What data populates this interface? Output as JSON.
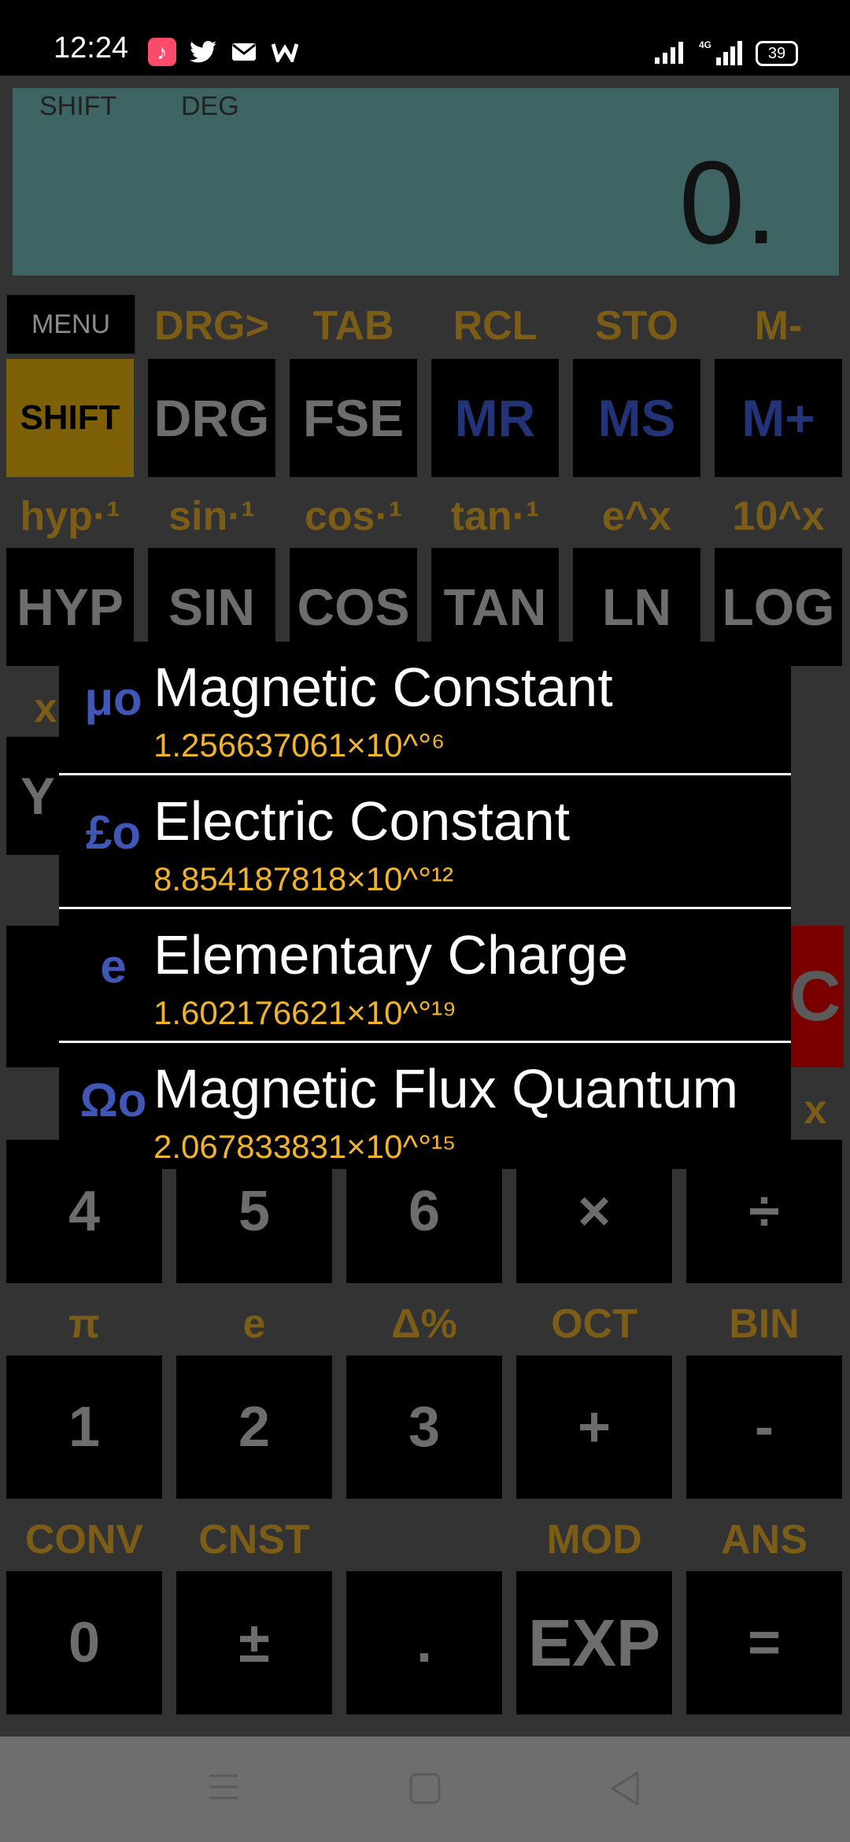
{
  "status_bar": {
    "time": "12:24",
    "icons": [
      "music-icon",
      "twitter-icon",
      "mail-icon",
      "w-icon",
      "signal-icon",
      "4g-signal-icon",
      "battery-icon"
    ],
    "network": "4G",
    "battery": "39"
  },
  "display": {
    "shift_indicator": "SHIFT",
    "angle_mode": "DEG",
    "value": "0."
  },
  "menu_label": "MENU",
  "row1_secondary": [
    "DRG>",
    "TAB",
    "RCL",
    "STO",
    "M-"
  ],
  "row1_keys": [
    "SHIFT",
    "DRG",
    "FSE",
    "MR",
    "MS",
    "M+"
  ],
  "row2_secondary": [
    "hyp·¹",
    "sin·¹",
    "cos·¹",
    "tan·¹",
    "e^x",
    "10^x"
  ],
  "row2_keys": [
    "HYP",
    "SIN",
    "COS",
    "TAN",
    "LN",
    "LOG"
  ],
  "partial_left": {
    "label": "x",
    "key": "Y"
  },
  "partial_right": {
    "key": "C",
    "label": "x"
  },
  "row5_keys": [
    "4",
    "5",
    "6",
    "×",
    "÷"
  ],
  "row6_secondary": [
    "π",
    "e",
    "Δ%",
    "OCT",
    "BIN"
  ],
  "row6_keys": [
    "1",
    "2",
    "3",
    "+",
    "-"
  ],
  "row7_secondary": [
    "CONV",
    "CNST",
    "",
    "MOD",
    "ANS"
  ],
  "row7_keys": [
    "0",
    "±",
    ".",
    "EXP",
    "="
  ],
  "constants_popup": [
    {
      "symbol": "μo",
      "name": "Magnetic Constant",
      "value": "1.256637061×10^°⁶"
    },
    {
      "symbol": "£o",
      "name": "Electric Constant",
      "value": "8.854187818×10^°¹²"
    },
    {
      "symbol": "e",
      "name": "Elementary Charge",
      "value": "1.602176621×10^°¹⁹"
    },
    {
      "symbol": "Ωo",
      "name": "Magnetic Flux Quantum",
      "value": "2.067833831×10^°¹⁵"
    }
  ],
  "nav_bar": [
    "menu-icon",
    "home-icon",
    "back-icon"
  ]
}
